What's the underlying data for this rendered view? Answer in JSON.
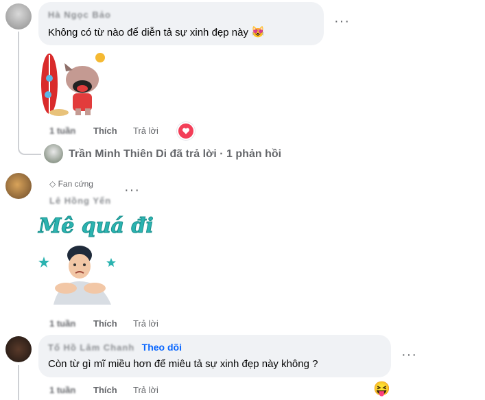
{
  "comments": [
    {
      "author": "Hà Ngọc Bảo",
      "text": "Không có từ nào để diễn tả sự xinh đẹp này",
      "emoji": "😻",
      "time": "1 tuần",
      "like_label": "Thích",
      "reply_label": "Trả lời",
      "reaction": "heart"
    },
    {
      "badge": "Fan cứng",
      "author": "Lê Hồng Yến",
      "sticker_text": "Mê quá đi",
      "time": "1 tuần",
      "like_label": "Thích",
      "reply_label": "Trả lời"
    },
    {
      "author": "Tố Hồ Lâm Chanh",
      "follow_label": "Theo dõi",
      "text": "Còn từ gì mĩ miều hơn để miêu tả sự xinh đẹp này không ?",
      "time": "1 tuần",
      "like_label": "Thích",
      "reply_label": "Trả lời",
      "emoji": "😝"
    }
  ],
  "reply_summary": "Trần Minh Thiên Di đã trả lời · 1 phản hồi",
  "more_label": "···",
  "colors": {
    "bubble": "#f0f2f5",
    "link": "#0866ff",
    "secondary": "#65676b"
  }
}
